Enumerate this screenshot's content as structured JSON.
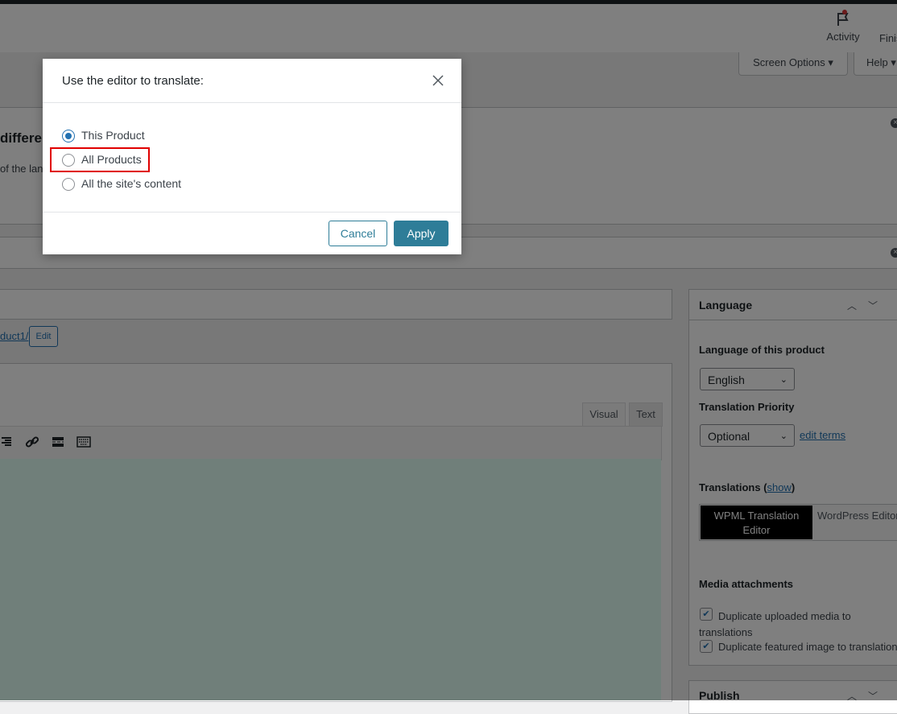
{
  "header": {
    "activity_label": "Activity",
    "finish_label": "Finis",
    "screen_options_label": "Screen Options ▾",
    "help_label": "Help ▾"
  },
  "notice": {
    "title_fragment": "differen",
    "text_fragment": "of the lan"
  },
  "editor": {
    "permalink_fragment": "duct1/",
    "edit_button": "Edit",
    "tab_visual": "Visual",
    "tab_text": "Text"
  },
  "sidebar": {
    "language_title": "Language",
    "language_of_product_label": "Language of this product",
    "language_value": "English",
    "translation_priority_label": "Translation Priority",
    "priority_value": "Optional",
    "edit_terms_link": "edit terms",
    "translations_label": "Translations (",
    "translations_show": "show",
    "translations_close": ")",
    "editor_option_active": "WPML Translation Editor",
    "editor_option_other": "WordPress Editor",
    "media_attachments_label": "Media attachments",
    "duplicate_media_label": "Duplicate uploaded media to translations",
    "duplicate_featured_label": "Duplicate featured image to translation",
    "publish_title": "Publish"
  },
  "modal": {
    "title": "Use the editor to translate:",
    "options": [
      {
        "label": "This Product",
        "selected": true
      },
      {
        "label": "All Products",
        "selected": false
      },
      {
        "label": "All the site's content",
        "selected": false
      }
    ],
    "cancel_label": "Cancel",
    "apply_label": "Apply"
  },
  "colors": {
    "accent": "#2e7d98",
    "highlight": "#e00000",
    "link": "#2271b1"
  }
}
